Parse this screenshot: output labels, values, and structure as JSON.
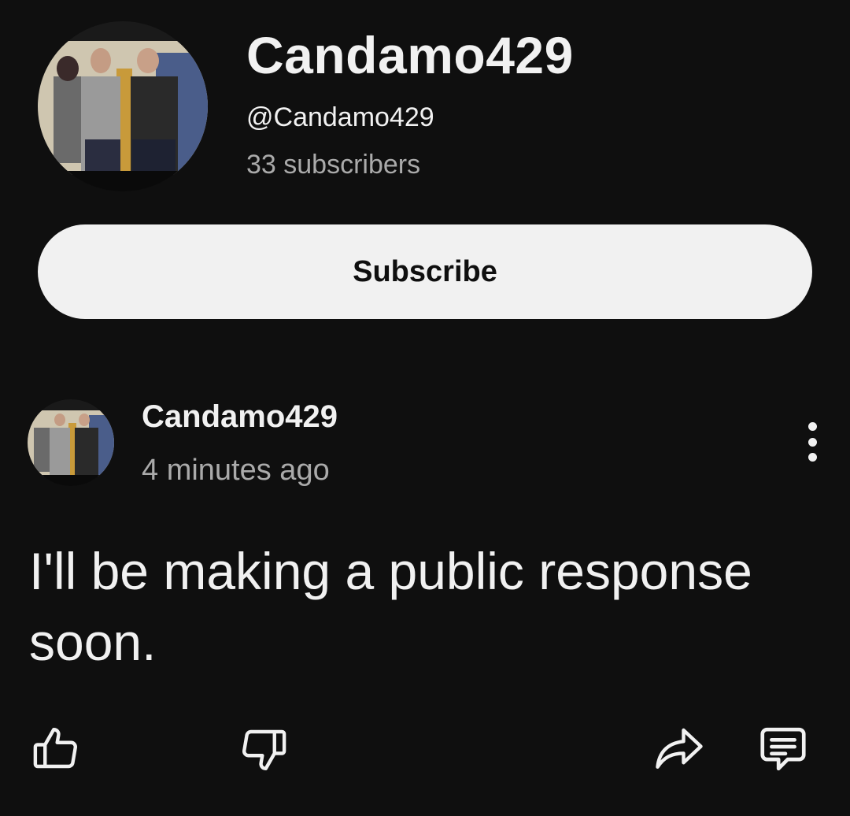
{
  "channel": {
    "name": "Candamo429",
    "handle": "@Candamo429",
    "subscribers": "33 subscribers",
    "subscribe_label": "Subscribe"
  },
  "post": {
    "author": "Candamo429",
    "time": "4 minutes ago",
    "text": "I'll be making a public response soon."
  },
  "icons": {
    "like": "thumbs-up-icon",
    "dislike": "thumbs-down-icon",
    "share": "share-icon",
    "comment": "comment-icon",
    "more": "more-vertical-icon"
  },
  "colors": {
    "background": "#0f0f0f",
    "text": "#f1f1f1",
    "secondary_text": "#aaaaaa",
    "button_bg": "#f1f1f1",
    "button_text": "#0f0f0f"
  }
}
